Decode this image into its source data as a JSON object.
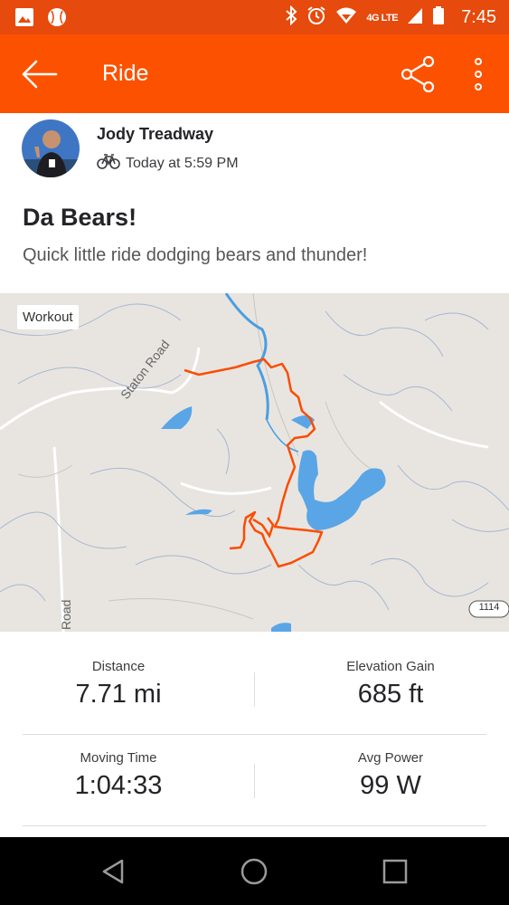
{
  "status": {
    "time": "7:45",
    "network": "4G LTE"
  },
  "app_bar": {
    "title": "Ride"
  },
  "athlete": {
    "name": "Jody Treadway",
    "timestamp": "Today at 5:59 PM"
  },
  "activity": {
    "title": "Da Bears!",
    "description": "Quick little ride dodging bears and thunder!"
  },
  "map": {
    "tag": "Workout",
    "road_label": "Staton Road",
    "road_label_2": "Road",
    "route_shield": "1114",
    "route_color": "#fc4c02",
    "water_color": "#5aa5e6"
  },
  "stats": [
    {
      "label": "Distance",
      "value": "7.71 mi"
    },
    {
      "label": "Elevation Gain",
      "value": "685 ft"
    },
    {
      "label": "Moving Time",
      "value": "1:04:33"
    },
    {
      "label": "Avg Power",
      "value": "99 W"
    }
  ],
  "colors": {
    "brand": "#fc5200",
    "status_bar": "#e64a0c"
  }
}
